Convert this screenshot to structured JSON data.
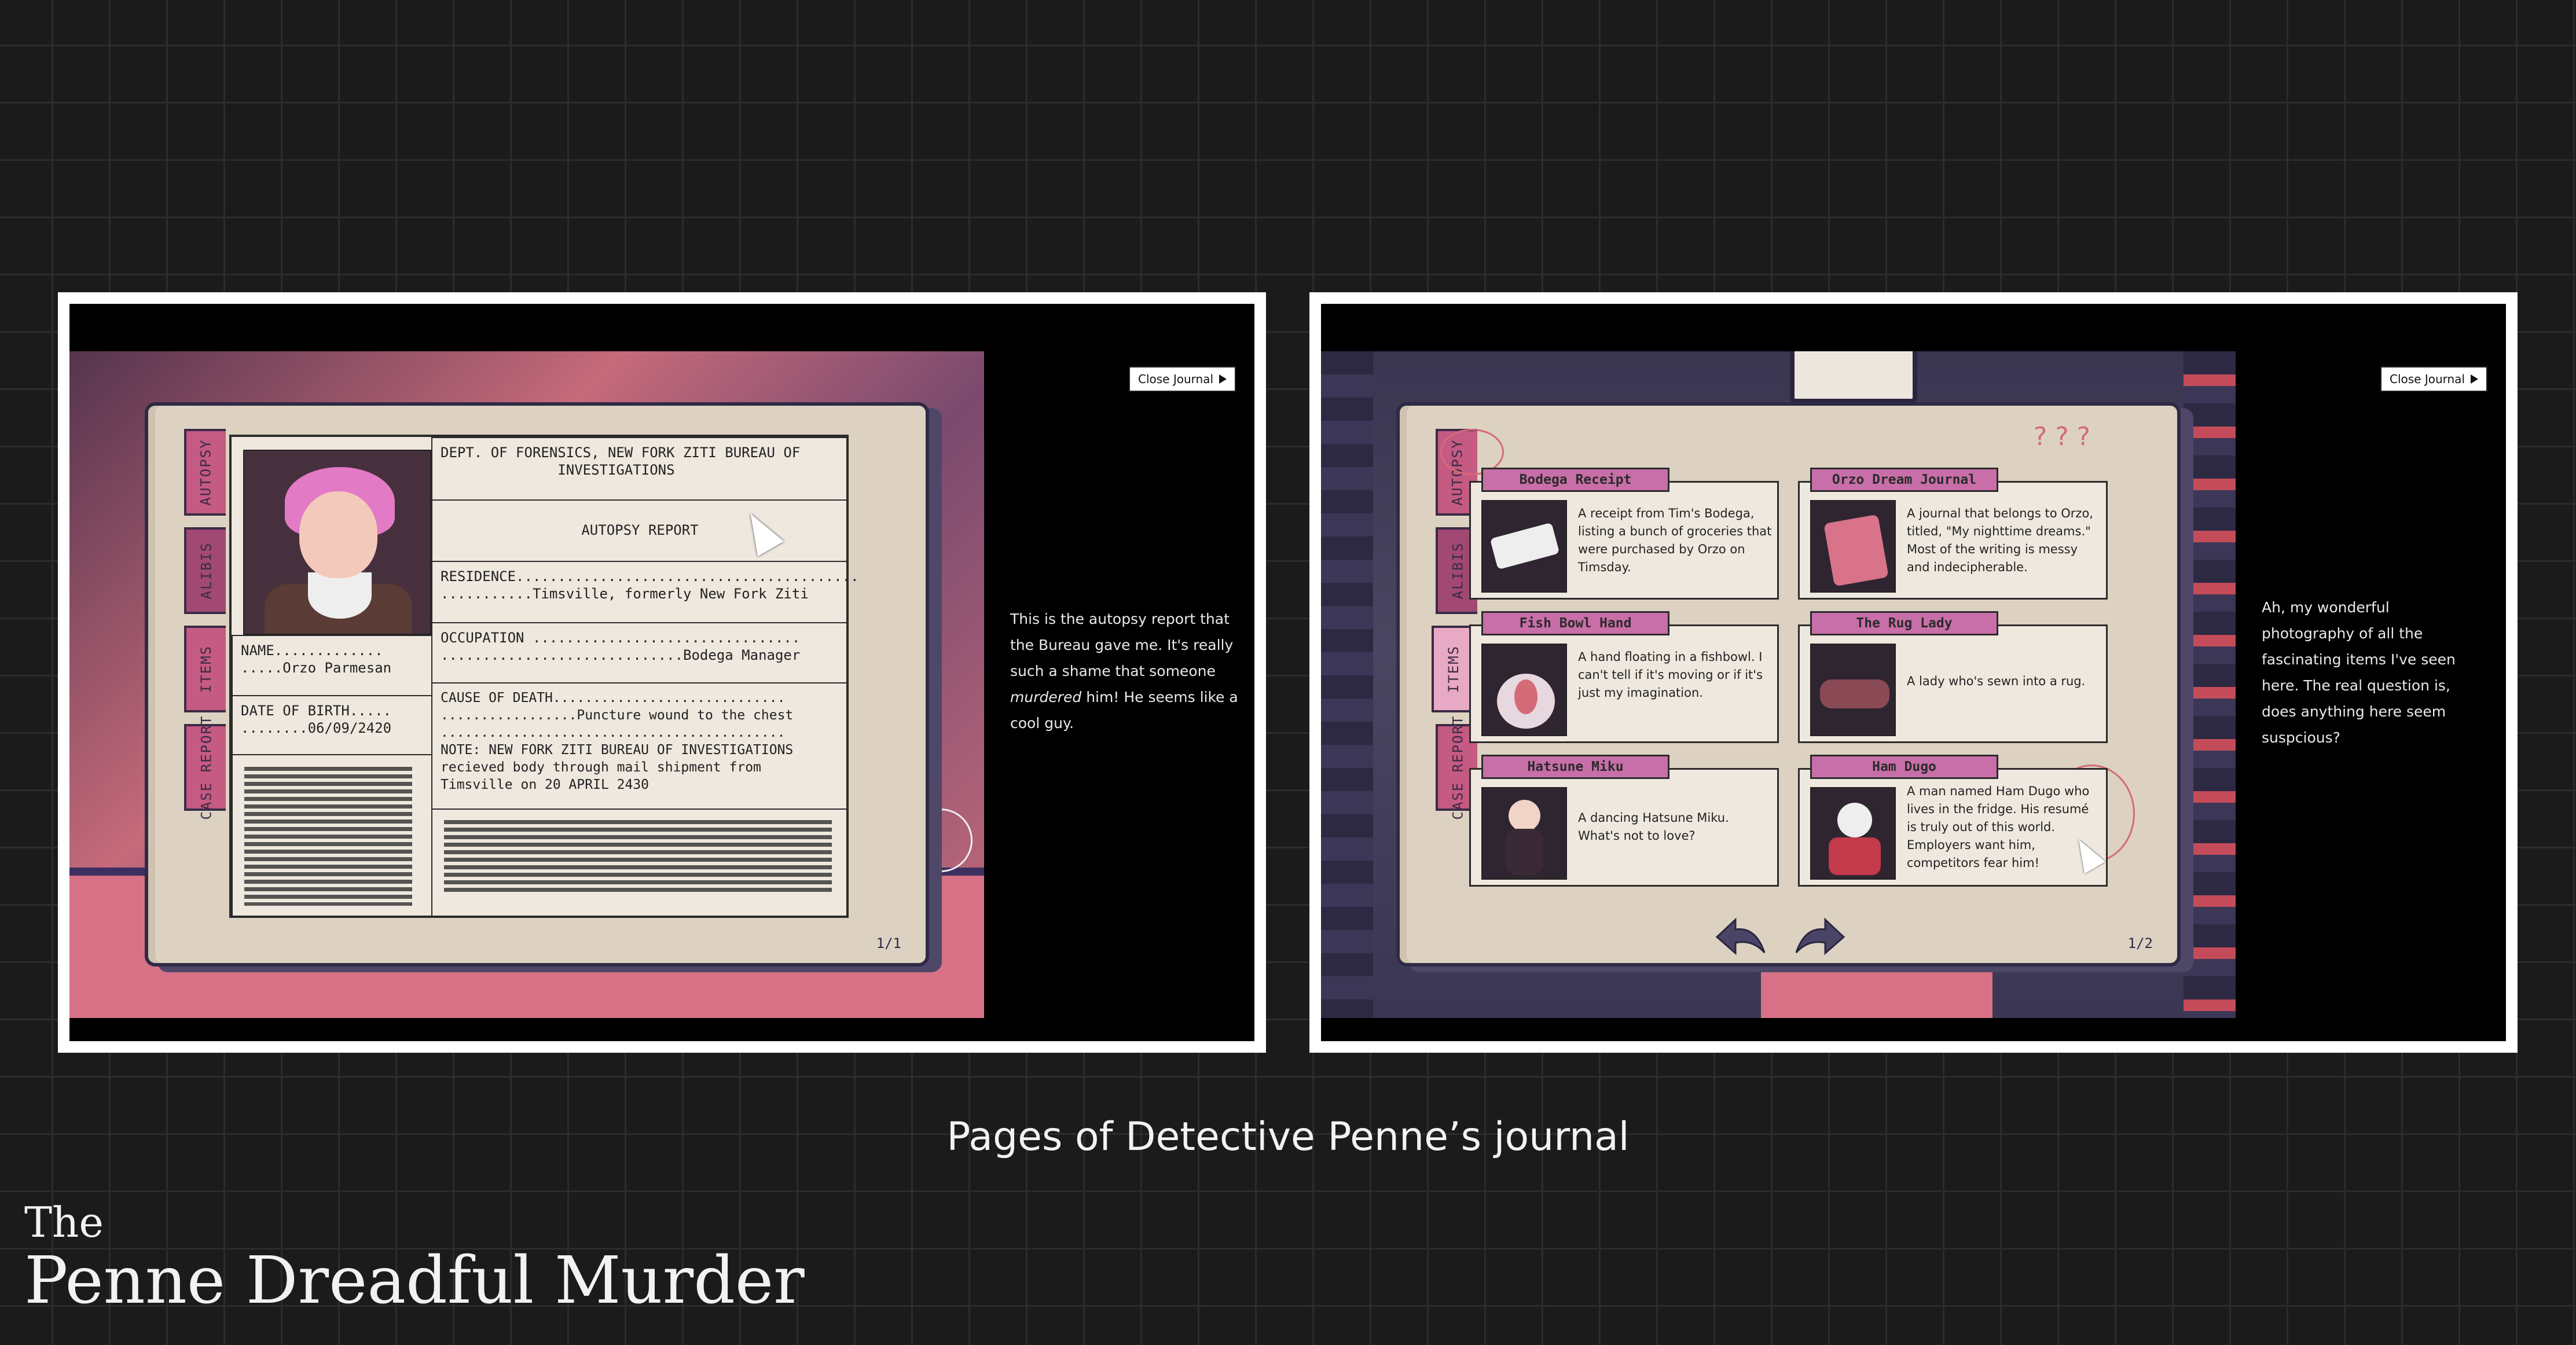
{
  "caption": "Pages of Detective Penne’s journal",
  "game_title": {
    "line1": "The",
    "line2": "Penne Dreadful Murder"
  },
  "tabs": [
    "AUTOPSY",
    "ALIBIS",
    "ITEMS",
    "CASE REPORT"
  ],
  "close_label": "Close Journal",
  "left_screen": {
    "report": {
      "header": "DEPT. OF FORENSICS, NEW FORK ZITI BUREAU OF\n              INVESTIGATIONS",
      "title": "AUTOPSY REPORT",
      "residence": "RESIDENCE.........................................\n...........Timsville, formerly New Fork Ziti",
      "occupation": "OCCUPATION ................................\n.............................Bodega Manager",
      "cause": "CAUSE OF DEATH.............................\n.................Puncture wound to the chest\n...........................................\nNOTE: NEW FORK ZITI BUREAU OF INVESTIGATIONS\nrecieved body through mail shipment from\nTimsville on 20 APRIL 2430",
      "name": "NAME.............\n.....Orzo Parmesan",
      "dob": "DATE OF BIRTH.....\n........06/09/2420"
    },
    "page": "1/1",
    "narration_before": "This is the autopsy report that the Bureau gave me. It's really such a shame that someone ",
    "narration_em": "murdered",
    "narration_after": " him! He seems like a cool guy."
  },
  "right_screen": {
    "items": [
      {
        "title": "Bodega Receipt",
        "desc": "A receipt from Tim's Bodega, listing a bunch of groceries that were purchased by Orzo on Timsday.",
        "icon": "receipt-photo"
      },
      {
        "title": "Orzo Dream Journal",
        "desc": "A journal that belongs to Orzo, titled, \"My nighttime dreams.\" Most of the writing is messy and indecipherable.",
        "icon": "journal-photo"
      },
      {
        "title": "Fish Bowl Hand",
        "desc": "A hand floating in a fishbowl. I can't tell if it's moving or if it's just my imagination.",
        "icon": "fishbowl-photo"
      },
      {
        "title": "The Rug Lady",
        "desc": "A lady who's sewn into a rug.",
        "icon": "rug-photo"
      },
      {
        "title": "Hatsune Miku",
        "desc": "A dancing Hatsune Miku. What's not to love?",
        "icon": "miku-photo"
      },
      {
        "title": "Ham Dugo",
        "desc": "A man named Ham Dugo who lives in the fridge. His resumé is truly out of this world. Employers want him, competitors fear him!",
        "icon": "ham-dugo-photo"
      }
    ],
    "page": "1/2",
    "doodle_text": "? ? ?",
    "narration": "Ah, my wonderful photography of all the fascinating items I've seen here. The real question is, does anything here seem suspcious?"
  },
  "colors": {
    "accent_pink": "#c86ea8",
    "tab_pink": "#c55a82",
    "paper": "#ddd2c2",
    "background": "#1b1b1b"
  }
}
